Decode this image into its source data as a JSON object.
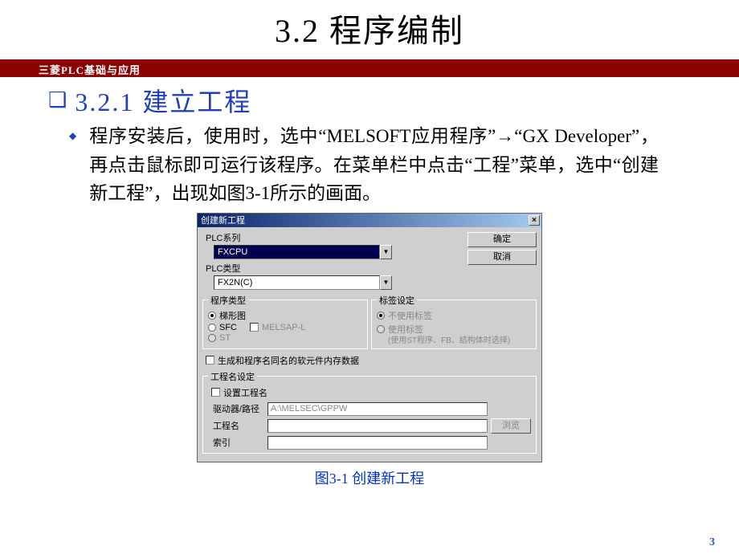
{
  "slide": {
    "title": "3.2   程序编制",
    "band": "三菱PLC基础与应用",
    "section": "3.2.1  建立工程",
    "paragraph": "程序安装后，使用时，选中“MELSOFT应用程序”→“GX Developer”，再点击鼠标即可运行该程序。在菜单栏中点击“工程”菜单，选中“创建新工程”，出现如图3-1所示的画面。",
    "caption": "图3-1  创建新工程",
    "page": "3"
  },
  "dialog": {
    "title": "创建新工程",
    "close": "×",
    "ok": "确定",
    "cancel": "取消",
    "plc_series_label": "PLC系列",
    "plc_series_value": "FXCPU",
    "plc_type_label": "PLC类型",
    "plc_type_value": "FX2N(C)",
    "prog_group": "程序类型",
    "tag_group": "标签设定",
    "radio_ladder": "梯形图",
    "radio_sfc": "SFC",
    "melsap": "MELSAP-L",
    "radio_st": "ST",
    "tag_none": "不使用标签",
    "tag_use": "使用标签",
    "tag_note": "(使用ST程序、FB、结构体时选择)",
    "gen_chk": "生成和程序名同名的软元件内存数据",
    "proj_group": "工程名设定",
    "set_proj": "设置工程名",
    "path_label": "驱动器/路径",
    "path_value": "A:\\MELSEC\\GPPW",
    "proj_label": "工程名",
    "index_label": "索引",
    "browse": "浏览"
  }
}
